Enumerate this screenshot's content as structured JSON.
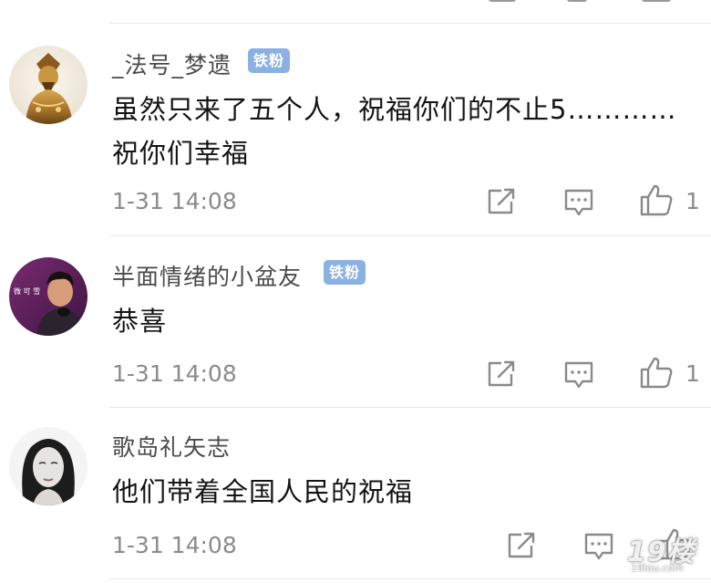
{
  "comments": [
    {
      "username": "_法号_梦遗",
      "badge": "铁粉",
      "content_lines": [
        "虽然只来了五个人，祝福你们的不止5…………",
        "祝你们幸福"
      ],
      "time": "1-31 14:08",
      "like_count": "1",
      "avatar_icon": "guan-yu-statue-avatar"
    },
    {
      "username": "半面情绪的小盆友",
      "badge": "铁粉",
      "content_lines": [
        "恭喜"
      ],
      "time": "1-31 14:08",
      "like_count": "1",
      "avatar_icon": "man-portrait-avatar"
    },
    {
      "username": "歌岛礼矢志",
      "badge": "",
      "content_lines": [
        "他们带着全国人民的祝福"
      ],
      "time": "1-31 14:08",
      "like_count": "",
      "avatar_icon": "woman-portrait-avatar"
    }
  ],
  "watermark": {
    "main": "19楼",
    "sub": "19lou.com"
  },
  "colors": {
    "badge_bg": "#8bb1e2",
    "divider": "#e8e8e8",
    "meta_text": "#8b8b8b",
    "icon_stroke": "#8a8a8a"
  },
  "icons": [
    "forward-icon",
    "reply-icon",
    "like-icon"
  ]
}
